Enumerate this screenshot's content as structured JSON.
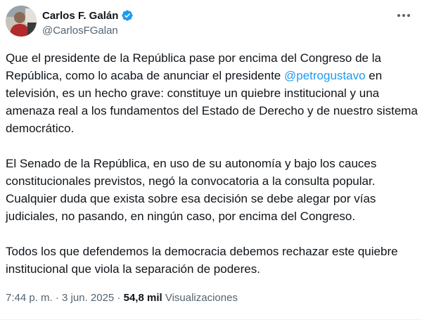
{
  "author": {
    "display_name": "Carlos F. Galán",
    "handle": "@CarlosFGalan",
    "avatar_icon": "avatar-photo",
    "verified_icon": "verified-badge-icon",
    "verified_color": "#1d9bf0"
  },
  "menu": {
    "icon": "more-horizontal-icon"
  },
  "tweet": {
    "p1_a": "Que el presidente de la República pase por encima del Congreso de la República, como lo acaba de anunciar el presidente ",
    "p1_mention": "@petrogustavo",
    "p1_b": " en televisión, es un hecho grave: constituye un quiebre institucional y una amenaza real a los fundamentos del Estado de Derecho y de nuestro sistema democrático.",
    "p2": "El Senado de la República, en uso de su autonomía y bajo los cauces constitucionales previstos, negó la convocatoria a la consulta popular. Cualquier duda que exista sobre esa decisión se debe alegar por vías judiciales, no pasando, en ningún caso, por encima del Congreso.",
    "p3": "Todos los que defendemos la democracia debemos rechazar este quiebre institucional que viola la separación de poderes."
  },
  "meta": {
    "time": "7:44 p. m.",
    "sep1": " · ",
    "date": "3 jun. 2025",
    "sep2": " · ",
    "views_count": "54,8 mil",
    "views_label": " Visualizaciones"
  },
  "colors": {
    "text": "#0f1419",
    "secondary": "#536471",
    "accent": "#1d9bf0"
  }
}
